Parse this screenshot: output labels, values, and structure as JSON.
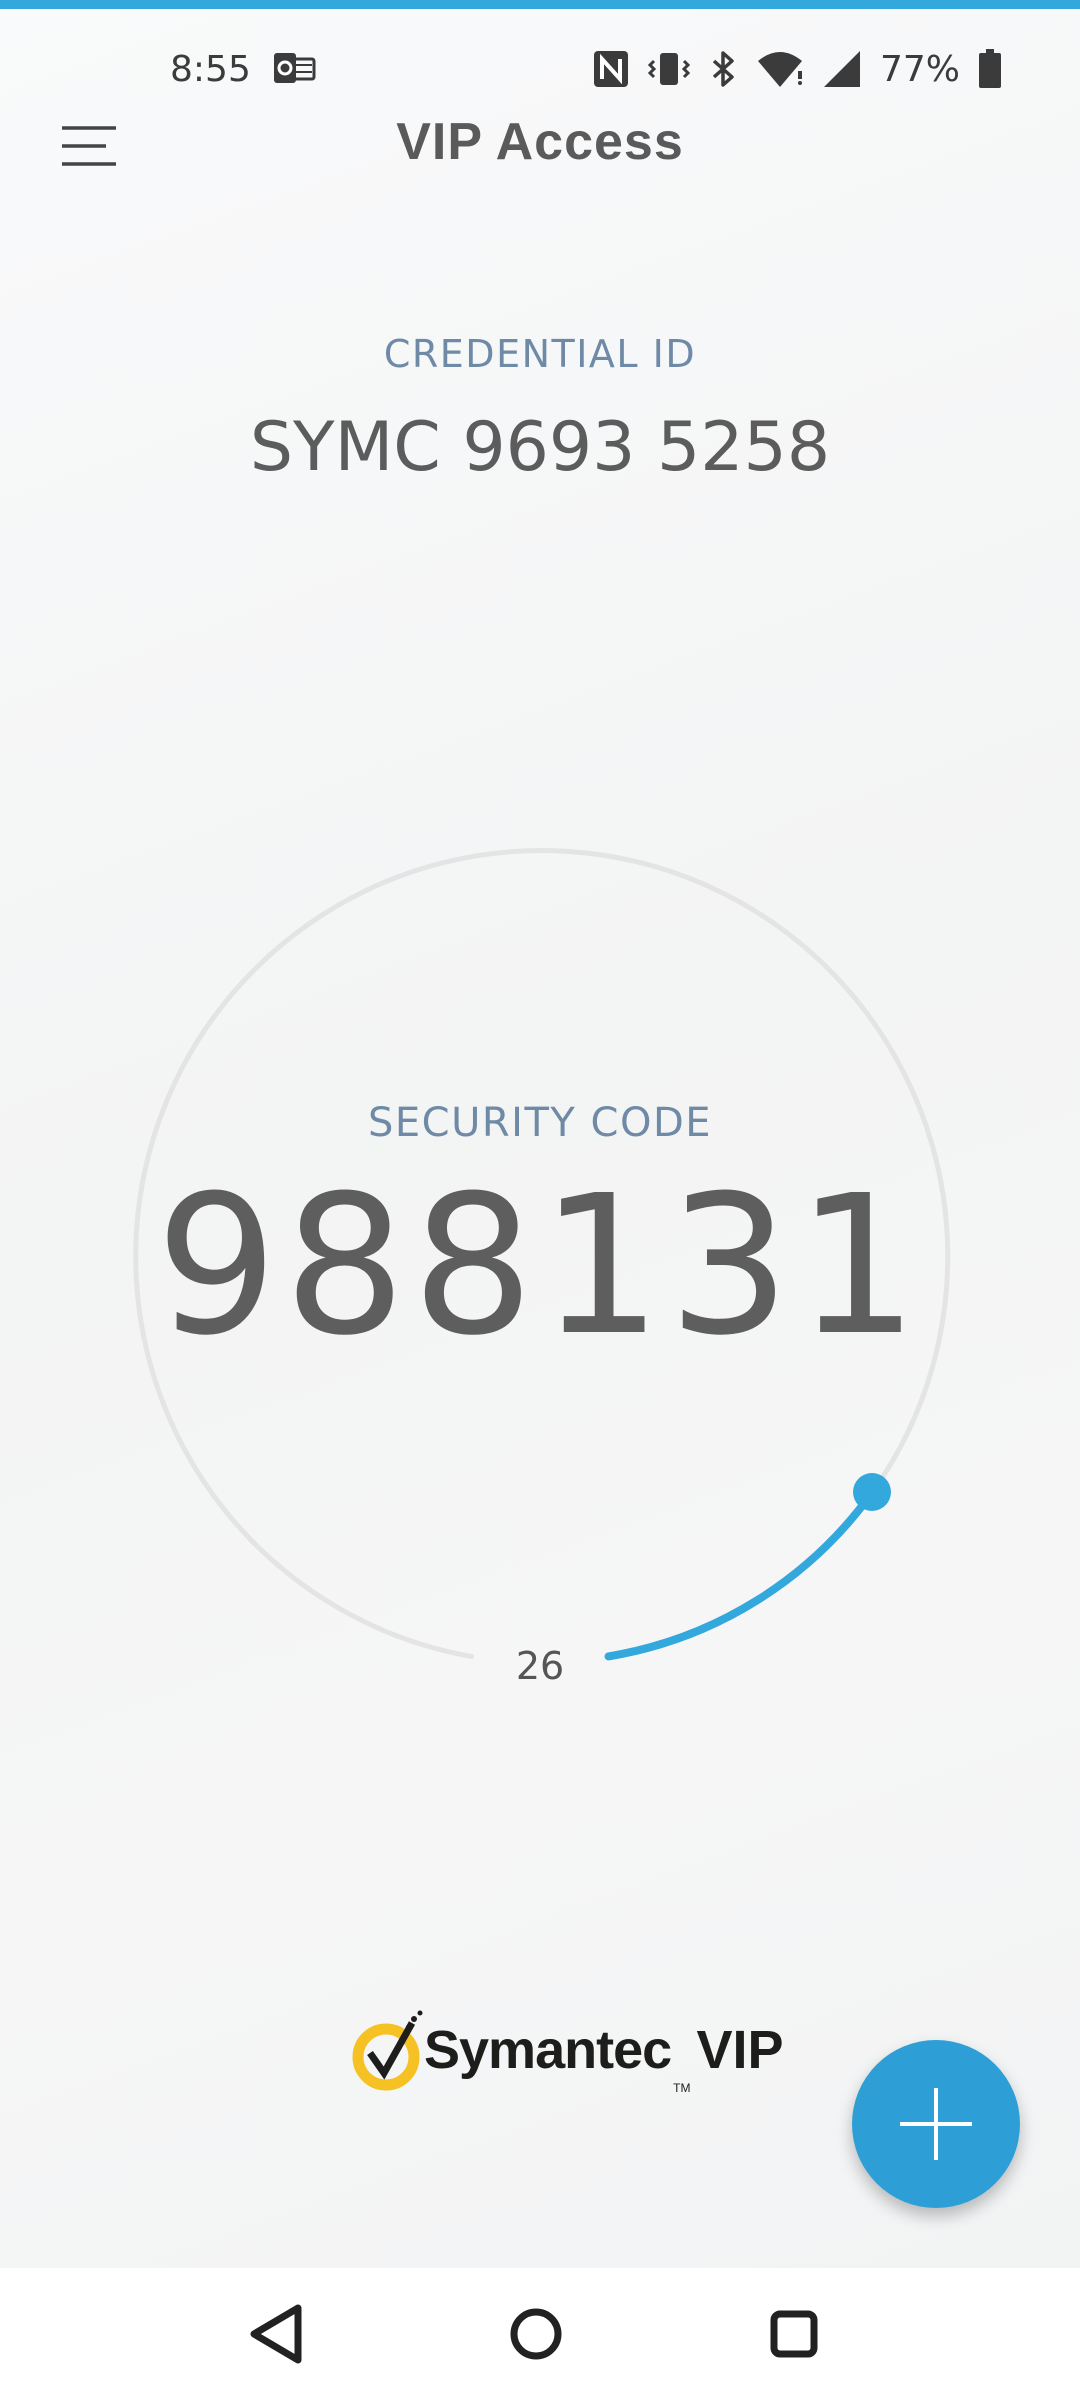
{
  "status_bar": {
    "time": "8:55",
    "battery_percent": "77%",
    "icons": [
      "outlook-notification-icon",
      "nfc-icon",
      "vibrate-icon",
      "bluetooth-icon",
      "wifi-icon",
      "cellular-signal-icon",
      "battery-icon"
    ]
  },
  "app_bar": {
    "title": "VIP Access",
    "menu_icon": "hamburger-menu-icon"
  },
  "credential": {
    "label": "CREDENTIAL ID",
    "value": "SYMC 9693 5258"
  },
  "security_code": {
    "label": "SECURITY CODE",
    "value": "988131",
    "seconds_remaining": "26",
    "timer_remaining_fraction": 0.12
  },
  "branding": {
    "logo_word": "Symantec",
    "logo_tm": "TM",
    "logo_product": "VIP"
  },
  "fab": {
    "icon": "plus-icon"
  },
  "navigation": {
    "icons": [
      "back-icon",
      "home-icon",
      "recents-icon"
    ]
  },
  "colors": {
    "accent": "#33a8dc",
    "fab": "#2d9fd6",
    "label": "#6f8aa6",
    "ring_track": "#e2e2e2",
    "logo_yellow": "#f6c122"
  }
}
